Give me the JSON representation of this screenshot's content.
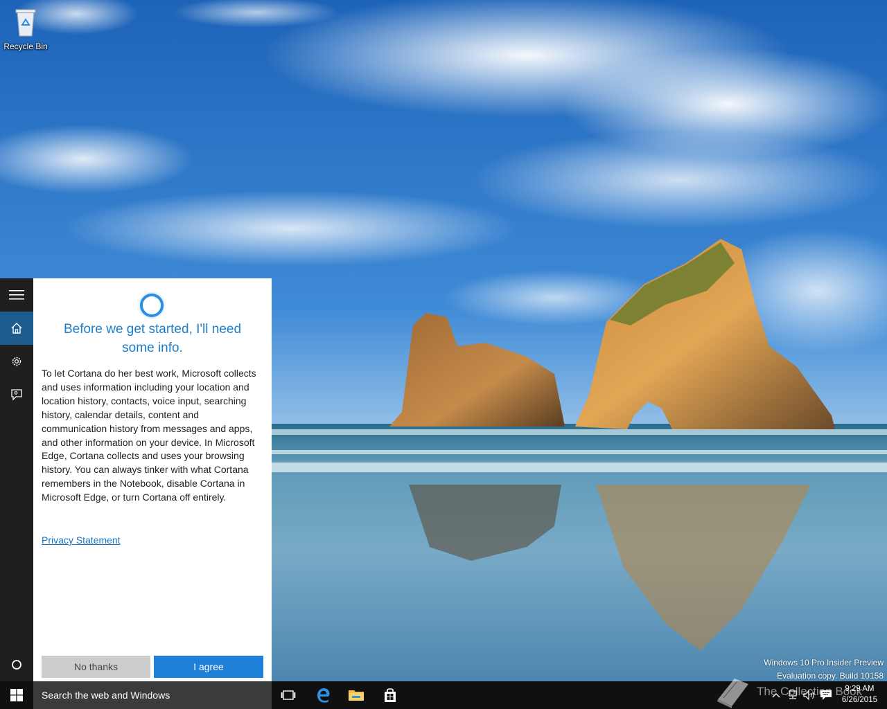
{
  "desktop": {
    "recycle_bin_label": "Recycle Bin",
    "watermark_line1": "Windows 10 Pro Insider Preview",
    "watermark_line2": "Evaluation copy. Build 10158"
  },
  "cortana": {
    "rail_items": [
      {
        "icon": "hamburger-menu-icon"
      },
      {
        "icon": "home-icon",
        "active": true
      },
      {
        "icon": "gear-icon"
      },
      {
        "icon": "feedback-icon"
      },
      {
        "icon": "cortana-circle-icon"
      }
    ],
    "title": "Before we get started, I'll need some info.",
    "body": "To let Cortana do her best work, Microsoft collects and uses information including your location and location history, contacts, voice input, searching history, calendar details, content and communication history from messages and apps, and other information on your device. In Microsoft Edge, Cortana collects and uses your browsing history. You can always tinker with what Cortana remembers in the Notebook, disable Cortana in Microsoft Edge, or turn Cortana off entirely.",
    "privacy_link": "Privacy Statement",
    "no_thanks": "No thanks",
    "agree": "I agree",
    "accent": "#1e80d8"
  },
  "taskbar": {
    "search_placeholder": "Search the web and Windows",
    "pinned": [
      "task-view-icon",
      "edge-icon",
      "file-explorer-icon",
      "store-icon"
    ],
    "tray": [
      "chevron-up-icon",
      "network-icon",
      "volume-icon",
      "action-center-icon"
    ],
    "time": "9:29 AM",
    "date": "6/26/2015"
  },
  "brand_overlay": {
    "text": "The Collection Book"
  }
}
